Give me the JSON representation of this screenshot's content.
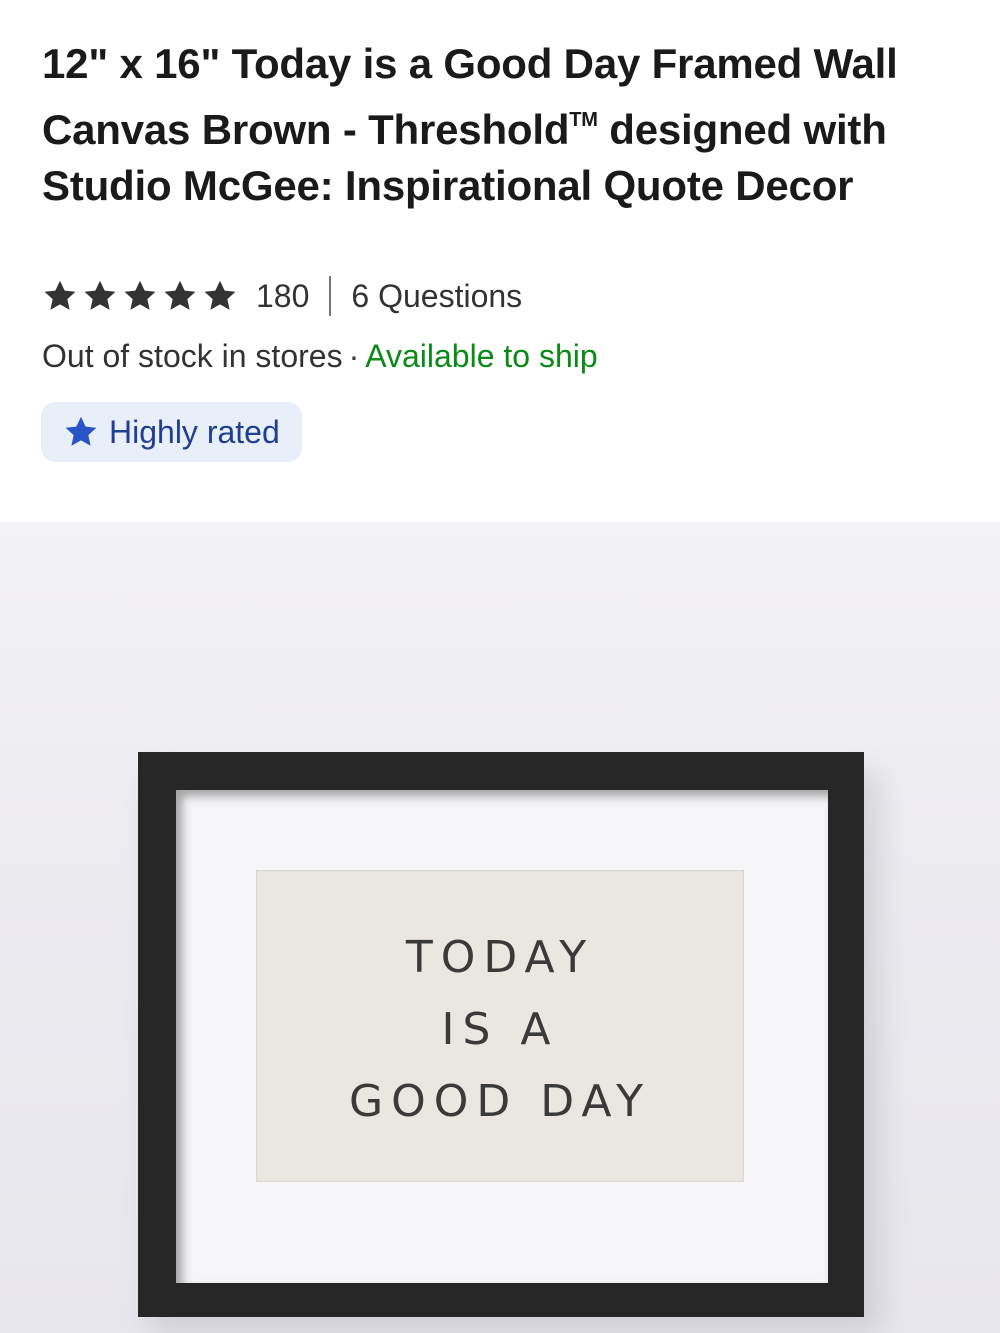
{
  "product": {
    "title_main": "12\" x 16\" Today is a Good Day Framed Wall Canvas Brown - Threshold",
    "title_tm": "TM",
    "title_rest": " designed with Studio McGee: Inspirational Quote Decor"
  },
  "rating": {
    "stars": 5,
    "review_count": "180",
    "questions": "6 Questions"
  },
  "stock": {
    "store_status": "Out of stock in stores",
    "separator": "·",
    "ship_status": "Available to ship"
  },
  "badge": {
    "icon": "star-icon",
    "label": "Highly rated"
  },
  "image": {
    "quote_lines": [
      "TODAY",
      "IS A",
      "GOOD DAY"
    ]
  },
  "colors": {
    "ship_green": "#0a8a16",
    "badge_bg": "#e9eff9",
    "badge_blue": "#1e3f92",
    "star_dark": "#333333"
  }
}
